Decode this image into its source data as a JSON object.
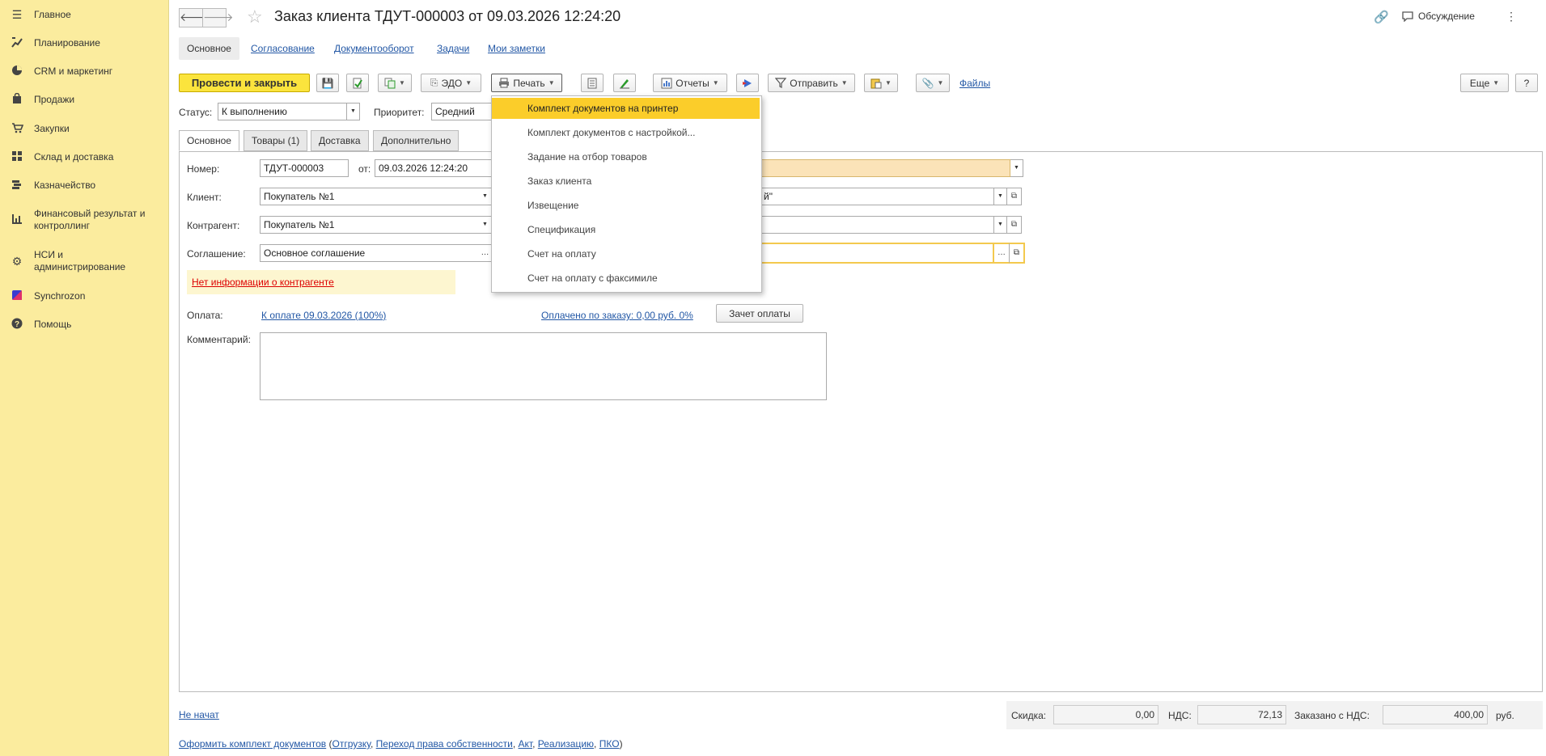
{
  "sidebar": {
    "items": [
      {
        "label": "Главное",
        "icon": "menu-icon"
      },
      {
        "label": "Планирование",
        "icon": "planning-icon"
      },
      {
        "label": "CRM и маркетинг",
        "icon": "pie-chart-icon"
      },
      {
        "label": "Продажи",
        "icon": "bag-icon"
      },
      {
        "label": "Закупки",
        "icon": "cart-icon"
      },
      {
        "label": "Склад и доставка",
        "icon": "warehouse-icon"
      },
      {
        "label": "Казначейство",
        "icon": "treasury-icon"
      },
      {
        "label": "Финансовый результат и контроллинг",
        "icon": "bar-chart-icon"
      },
      {
        "label": "НСИ и администрирование",
        "icon": "gear-icon"
      },
      {
        "label": "Synchrozon",
        "icon": "synchrozon-icon"
      },
      {
        "label": "Помощь",
        "icon": "help-icon"
      }
    ]
  },
  "header": {
    "title": "Заказ клиента ТДУТ-000003 от 09.03.2026 12:24:20",
    "discussion": "Обсуждение"
  },
  "top_links": [
    "Основное",
    "Согласование",
    "Документооборот",
    "Задачи",
    "Мои заметки"
  ],
  "toolbar": {
    "post_close": "Провести и закрыть",
    "edo": "ЭДО",
    "print": "Печать",
    "reports": "Отчеты",
    "send": "Отправить",
    "files": "Файлы",
    "more": "Еще",
    "help": "?"
  },
  "status": {
    "status_label": "Статус:",
    "status_value": "К выполнению",
    "priority_label": "Приоритет:",
    "priority_value": "Средний"
  },
  "tabs": [
    "Основное",
    "Товары (1)",
    "Доставка",
    "Дополнительно"
  ],
  "form": {
    "number_label": "Номер:",
    "number_value": "ТДУТ-000003",
    "date_label": "от:",
    "date_value": "09.03.2026 12:24:20",
    "client_label": "Клиент:",
    "client_value": "Покупатель №1",
    "contractor_label": "Контрагент:",
    "contractor_value": "Покупатель №1",
    "agreement_label": "Соглашение:",
    "agreement_value": "Основное соглашение",
    "right_field_2": "й\"",
    "no_info_link": "Нет информации о контрагенте",
    "payment_label": "Оплата:",
    "payment_link": "К оплате 09.03.2026 (100%)",
    "paid_link": "Оплачено по заказу: 0,00 руб. 0%",
    "offset_button": "Зачет оплаты",
    "comment_label": "Комментарий:"
  },
  "print_menu": {
    "items": [
      "Комплект документов на принтер",
      "Комплект документов с настройкой...",
      "Задание на отбор товаров",
      "Заказ клиента",
      "Извещение",
      "Спецификация",
      "Счет на оплату",
      "Счет на оплату с факсимиле"
    ]
  },
  "footer": {
    "status_link": "Не начат",
    "discount_label": "Скидка:",
    "discount_value": "0,00",
    "vat_label": "НДС:",
    "vat_value": "72,13",
    "ordered_label": "Заказано с НДС:",
    "ordered_value": "400,00",
    "currency": "руб.",
    "docs_link": "Оформить комплект документов",
    "open_paren": "(",
    "docs_items": [
      "Отгрузку",
      "Переход права собственности",
      "Акт",
      "Реализацию",
      "ПКО"
    ],
    "comma": ",",
    "close_paren": ")"
  },
  "colors": {
    "sidebar_bg": "#fbec9e",
    "primary_button": "#fbe43d",
    "menu_highlight": "#fbcd2a",
    "link": "#2257a5",
    "warning_link": "#dd0000"
  }
}
